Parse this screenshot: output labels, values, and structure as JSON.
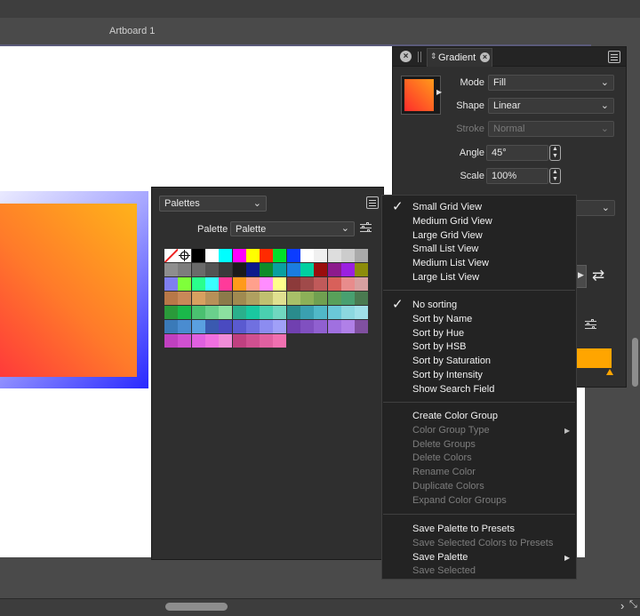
{
  "artboard": {
    "label": "Artboard 1"
  },
  "gradient_panel": {
    "tab_title": "Gradient",
    "fields": [
      {
        "label": "Mode",
        "value": "Fill",
        "type": "select",
        "enabled": true
      },
      {
        "label": "Shape",
        "value": "Linear",
        "type": "select",
        "enabled": true
      },
      {
        "label": "Stroke",
        "value": "Normal",
        "type": "select",
        "enabled": false
      },
      {
        "label": "Angle",
        "value": "45°",
        "type": "number",
        "enabled": true
      },
      {
        "label": "Scale",
        "value": "100%",
        "type": "number",
        "enabled": true
      }
    ],
    "colors": {
      "fill_start": "#ff2c2c",
      "fill_end": "#ffa500"
    }
  },
  "palettes_panel": {
    "panel_dropdown": "Palettes",
    "palette_label": "Palette",
    "palette_value": "Palette",
    "swatches": [
      [
        "none",
        "registration",
        "#000000",
        "#ffffff",
        "#00ffff",
        "#ff00ff",
        "#ffff00",
        "#ff2a00",
        "#00e02a",
        "#0b3cff",
        "#ffffff",
        "#f0f0f0",
        "#dddddd",
        "#cccccc",
        "#aaaaaa"
      ],
      [
        "#8e8e8e",
        "#7d7d7d",
        "#6a6a6a",
        "#535353",
        "#3a3a3a",
        "#1a1a1a",
        "#0c1a8c",
        "#0e8c2a",
        "#0aa0a0",
        "#1b7de0",
        "#00d0a0",
        "#9a0d0d",
        "#8c1a8c",
        "#9b20e0",
        "#8c8c0a"
      ],
      [
        "#7f7ff0",
        "#7fff3a",
        "#2aff8c",
        "#3affff",
        "#ff3a9a",
        "#ff9a1a",
        "#ffa08c",
        "#ff8cff",
        "#ffff8c",
        "#8c3a3a",
        "#a04a4a",
        "#c05a5a",
        "#d8605a",
        "#e88c8c",
        "#d8a0a0"
      ],
      [
        "#b87848",
        "#c88858",
        "#d8a060",
        "#b89058",
        "#8c7a4a",
        "#a08a50",
        "#b0a060",
        "#c0c070",
        "#e0e090",
        "#a8c068",
        "#8cb058",
        "#70a050",
        "#58a05a",
        "#48a070",
        "#4a7a50"
      ],
      [
        "#2a9a3a",
        "#1ab84a",
        "#4ac070",
        "#6ad08c",
        "#8ce0a0",
        "#2ab08c",
        "#1ac8a0",
        "#4ad0b0",
        "#70d8c0",
        "#2a8c8c",
        "#3aa0b0",
        "#50b8c8",
        "#6ac8d8",
        "#8cd8e0",
        "#a0e0e8"
      ],
      [
        "#3a7ab8",
        "#4a8cd0",
        "#5aa0e0",
        "#3a5ab0",
        "#4a4ac0",
        "#5a5ad0",
        "#7070e0",
        "#8c8cf0",
        "#a0a0f8",
        "#7040b0",
        "#8050c0",
        "#9060d0",
        "#a070e0",
        "#b080e8",
        "#8050a0"
      ],
      [
        "#c040c0",
        "#d050d0",
        "#e060e0",
        "#f070e0",
        "#f08cd8",
        "#c04080",
        "#d05090",
        "#e060a0",
        "#f070b0"
      ]
    ]
  },
  "context_menu": {
    "view_items": [
      {
        "label": "Small Grid View",
        "checked": true,
        "enabled": true
      },
      {
        "label": "Medium Grid View",
        "checked": false,
        "enabled": true
      },
      {
        "label": "Large Grid View",
        "checked": false,
        "enabled": true
      },
      {
        "label": "Small List View",
        "checked": false,
        "enabled": true
      },
      {
        "label": "Medium List View",
        "checked": false,
        "enabled": true
      },
      {
        "label": "Large List View",
        "checked": false,
        "enabled": true
      }
    ],
    "sort_items": [
      {
        "label": "No sorting",
        "checked": true,
        "enabled": true
      },
      {
        "label": "Sort by Name",
        "checked": false,
        "enabled": true
      },
      {
        "label": "Sort by Hue",
        "checked": false,
        "enabled": true
      },
      {
        "label": "Sort by HSB",
        "checked": false,
        "enabled": true
      },
      {
        "label": "Sort by Saturation",
        "checked": false,
        "enabled": true
      },
      {
        "label": "Sort by Intensity",
        "checked": false,
        "enabled": true
      },
      {
        "label": "Show Search Field",
        "checked": false,
        "enabled": true
      }
    ],
    "group_items": [
      {
        "label": "Create Color Group",
        "enabled": true,
        "submenu": false
      },
      {
        "label": "Color Group Type",
        "enabled": false,
        "submenu": true
      },
      {
        "label": "Delete Groups",
        "enabled": false,
        "submenu": false
      },
      {
        "label": "Delete Colors",
        "enabled": false,
        "submenu": false
      },
      {
        "label": "Rename Color",
        "enabled": false,
        "submenu": false
      },
      {
        "label": "Duplicate Colors",
        "enabled": false,
        "submenu": false
      },
      {
        "label": "Expand Color Groups",
        "enabled": false,
        "submenu": false
      }
    ],
    "save_items": [
      {
        "label": "Save Palette to Presets",
        "enabled": true,
        "submenu": false
      },
      {
        "label": "Save Selected Colors to Presets",
        "enabled": false,
        "submenu": false
      },
      {
        "label": "Save Palette",
        "enabled": true,
        "submenu": true
      },
      {
        "label": "Save Selected",
        "enabled": false,
        "submenu": false
      }
    ]
  }
}
